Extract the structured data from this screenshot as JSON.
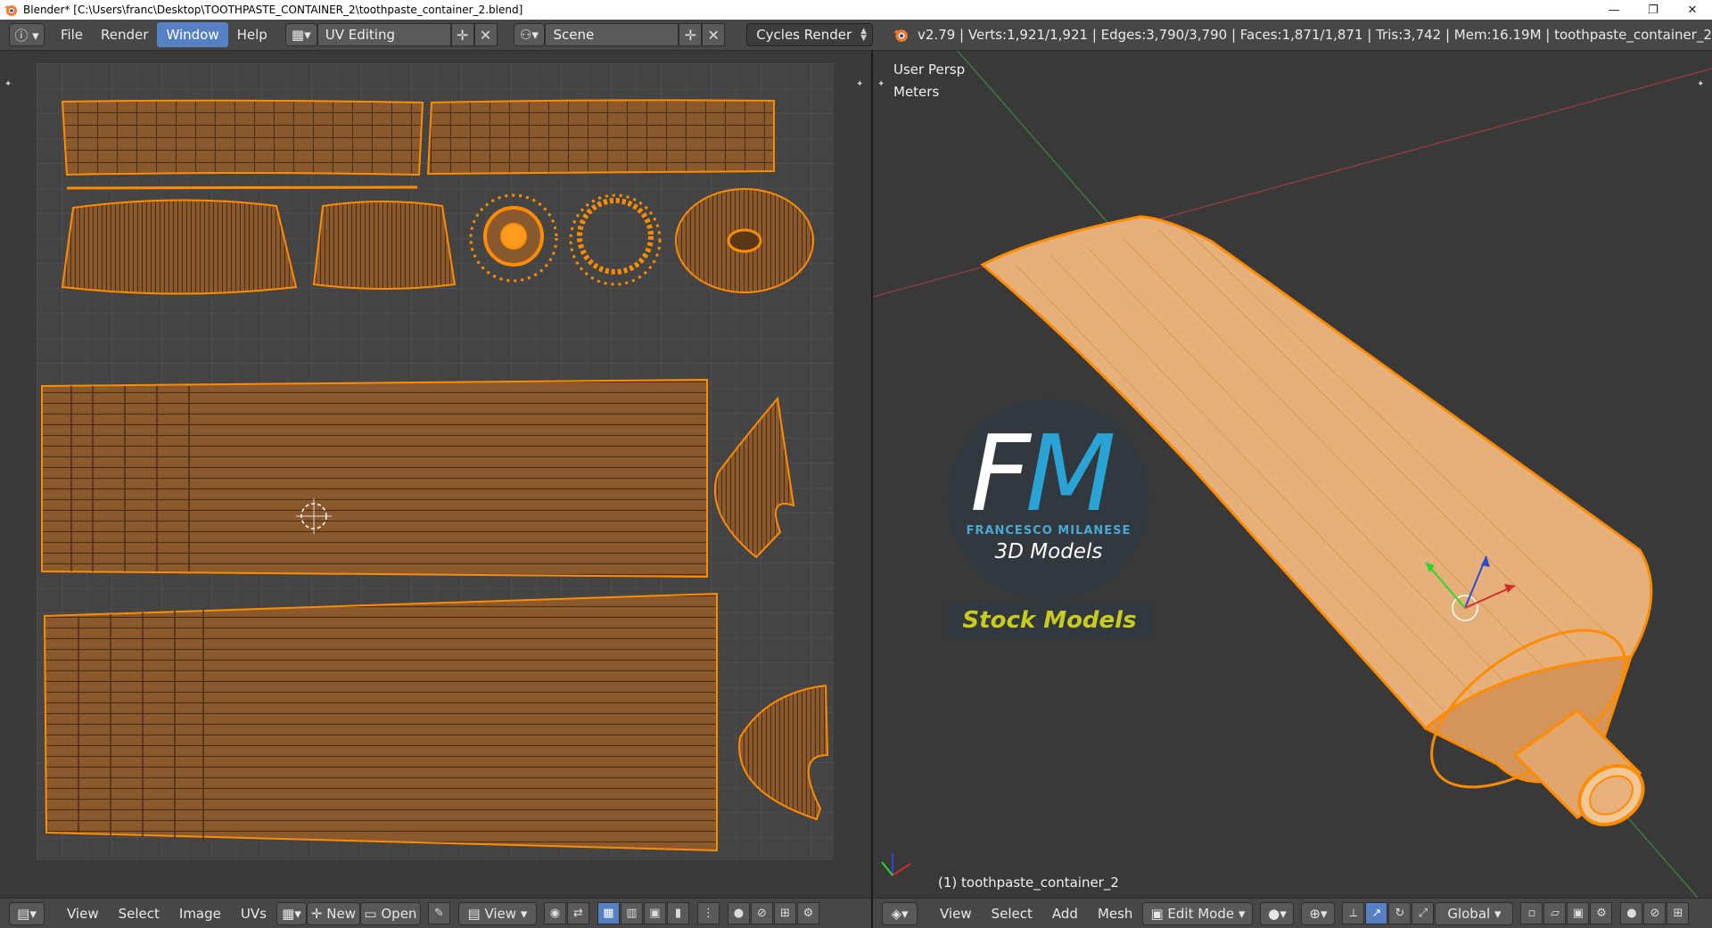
{
  "window": {
    "title": "Blender* [C:\\Users\\franc\\Desktop\\TOOTHPASTE_CONTAINER_2\\toothpaste_container_2.blend]",
    "controls": [
      "—",
      "❐",
      "✕"
    ]
  },
  "topbar": {
    "menus": [
      "File",
      "Render",
      "Window",
      "Help"
    ],
    "active_menu": "Window",
    "screen_layout": "UV Editing",
    "scene": "Scene",
    "render_engine": "Cycles Render",
    "stats": "v2.79 | Verts:1,921/1,921 | Edges:3,790/3,790 | Faces:1,871/1,871 | Tris:3,742 | Mem:16.19M | toothpaste_container_2"
  },
  "viewport": {
    "view_label": "User Persp",
    "units_label": "Meters",
    "object_label": "(1) toothpaste_container_2"
  },
  "watermark": {
    "letter_f": "F",
    "letter_m": "M",
    "name": "FRANCESCO MILANESE",
    "subtitle": "3D Models",
    "stock": "Stock Models"
  },
  "uv_bottombar": {
    "menus": [
      "View",
      "Select",
      "Image",
      "UVs"
    ],
    "new_label": "New",
    "open_label": "Open",
    "view_label": "View"
  },
  "vp_bottombar": {
    "menus": [
      "View",
      "Select",
      "Add",
      "Mesh"
    ],
    "mode": "Edit Mode",
    "orientation": "Global"
  },
  "colors": {
    "accent": "#5680c2",
    "mesh_edge": "#ff8c00",
    "mesh_fill": "#e7b27c",
    "uv_fill": "#8a5a2e"
  }
}
